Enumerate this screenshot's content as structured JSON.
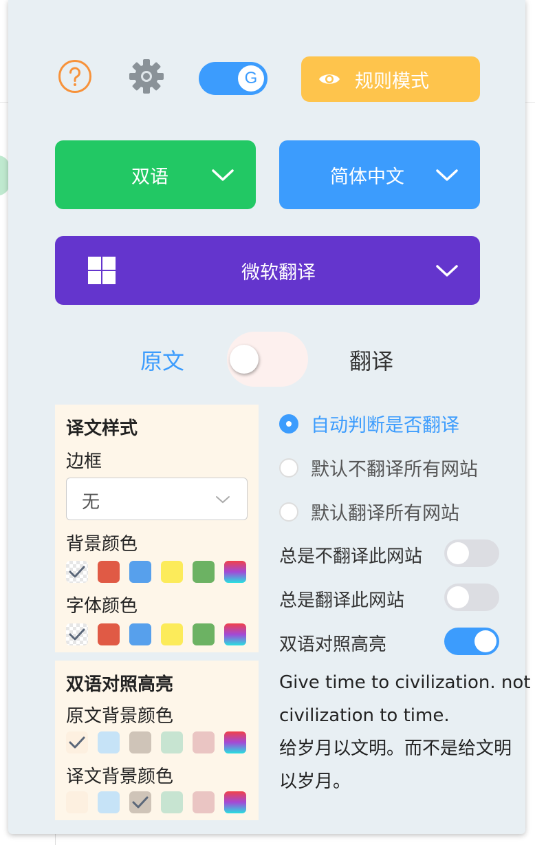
{
  "toolbar": {
    "help_icon": "help-circle-icon",
    "settings_icon": "gear-icon",
    "google_toggle_letter": "G",
    "rule_mode_label": "规则模式",
    "rule_mode_icon": "eye-icon"
  },
  "selectors": {
    "mode": "双语",
    "target_language": "简体中文",
    "engine": "微软翻译",
    "engine_icon": "windows-logo-icon"
  },
  "view_switch": {
    "left_label": "原文",
    "right_label": "翻译",
    "on": false
  },
  "style_panel": {
    "title": "译文样式",
    "border_label": "边框",
    "border_value": "无",
    "bg_color_label": "背景颜色",
    "font_color_label": "字体颜色",
    "colors": [
      "#e05a45",
      "#57a0ec",
      "#fceb5a",
      "#6cb263"
    ]
  },
  "highlight_panel": {
    "title": "双语对照高亮",
    "orig_bg_label": "原文背景颜色",
    "trans_bg_label": "译文背景颜色",
    "colors": [
      "#fdf0e0",
      "#c6e3f7",
      "#cfc4b8",
      "#c7e4d1",
      "#eac5c3"
    ]
  },
  "translate_options": {
    "radios": [
      {
        "label": "自动判断是否翻译",
        "selected": true
      },
      {
        "label": "默认不翻译所有网站",
        "selected": false
      },
      {
        "label": "默认翻译所有网站",
        "selected": false
      }
    ],
    "toggles": [
      {
        "label": "总是不翻译此网站",
        "on": false
      },
      {
        "label": "总是翻译此网站",
        "on": false
      },
      {
        "label": "双语对照高亮",
        "on": true
      }
    ]
  },
  "quote": {
    "line1": "Give time to civilization. not",
    "line2": "civilization to time.",
    "line3": "给岁月以文明。而不是给文明",
    "line4": "以岁月。"
  }
}
